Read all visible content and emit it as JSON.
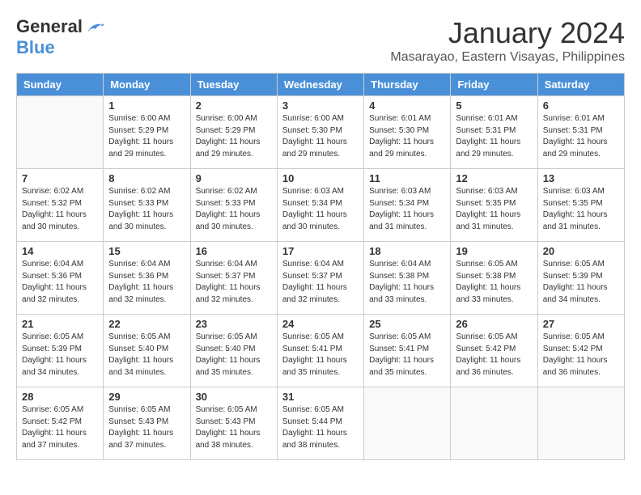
{
  "header": {
    "logo_general": "General",
    "logo_blue": "Blue",
    "month_title": "January 2024",
    "location": "Masarayao, Eastern Visayas, Philippines"
  },
  "weekdays": [
    "Sunday",
    "Monday",
    "Tuesday",
    "Wednesday",
    "Thursday",
    "Friday",
    "Saturday"
  ],
  "weeks": [
    [
      {
        "day": "",
        "sunrise": "",
        "sunset": "",
        "daylight": ""
      },
      {
        "day": "1",
        "sunrise": "Sunrise: 6:00 AM",
        "sunset": "Sunset: 5:29 PM",
        "daylight": "Daylight: 11 hours and 29 minutes."
      },
      {
        "day": "2",
        "sunrise": "Sunrise: 6:00 AM",
        "sunset": "Sunset: 5:29 PM",
        "daylight": "Daylight: 11 hours and 29 minutes."
      },
      {
        "day": "3",
        "sunrise": "Sunrise: 6:00 AM",
        "sunset": "Sunset: 5:30 PM",
        "daylight": "Daylight: 11 hours and 29 minutes."
      },
      {
        "day": "4",
        "sunrise": "Sunrise: 6:01 AM",
        "sunset": "Sunset: 5:30 PM",
        "daylight": "Daylight: 11 hours and 29 minutes."
      },
      {
        "day": "5",
        "sunrise": "Sunrise: 6:01 AM",
        "sunset": "Sunset: 5:31 PM",
        "daylight": "Daylight: 11 hours and 29 minutes."
      },
      {
        "day": "6",
        "sunrise": "Sunrise: 6:01 AM",
        "sunset": "Sunset: 5:31 PM",
        "daylight": "Daylight: 11 hours and 29 minutes."
      }
    ],
    [
      {
        "day": "7",
        "sunrise": "Sunrise: 6:02 AM",
        "sunset": "Sunset: 5:32 PM",
        "daylight": "Daylight: 11 hours and 30 minutes."
      },
      {
        "day": "8",
        "sunrise": "Sunrise: 6:02 AM",
        "sunset": "Sunset: 5:33 PM",
        "daylight": "Daylight: 11 hours and 30 minutes."
      },
      {
        "day": "9",
        "sunrise": "Sunrise: 6:02 AM",
        "sunset": "Sunset: 5:33 PM",
        "daylight": "Daylight: 11 hours and 30 minutes."
      },
      {
        "day": "10",
        "sunrise": "Sunrise: 6:03 AM",
        "sunset": "Sunset: 5:34 PM",
        "daylight": "Daylight: 11 hours and 30 minutes."
      },
      {
        "day": "11",
        "sunrise": "Sunrise: 6:03 AM",
        "sunset": "Sunset: 5:34 PM",
        "daylight": "Daylight: 11 hours and 31 minutes."
      },
      {
        "day": "12",
        "sunrise": "Sunrise: 6:03 AM",
        "sunset": "Sunset: 5:35 PM",
        "daylight": "Daylight: 11 hours and 31 minutes."
      },
      {
        "day": "13",
        "sunrise": "Sunrise: 6:03 AM",
        "sunset": "Sunset: 5:35 PM",
        "daylight": "Daylight: 11 hours and 31 minutes."
      }
    ],
    [
      {
        "day": "14",
        "sunrise": "Sunrise: 6:04 AM",
        "sunset": "Sunset: 5:36 PM",
        "daylight": "Daylight: 11 hours and 32 minutes."
      },
      {
        "day": "15",
        "sunrise": "Sunrise: 6:04 AM",
        "sunset": "Sunset: 5:36 PM",
        "daylight": "Daylight: 11 hours and 32 minutes."
      },
      {
        "day": "16",
        "sunrise": "Sunrise: 6:04 AM",
        "sunset": "Sunset: 5:37 PM",
        "daylight": "Daylight: 11 hours and 32 minutes."
      },
      {
        "day": "17",
        "sunrise": "Sunrise: 6:04 AM",
        "sunset": "Sunset: 5:37 PM",
        "daylight": "Daylight: 11 hours and 32 minutes."
      },
      {
        "day": "18",
        "sunrise": "Sunrise: 6:04 AM",
        "sunset": "Sunset: 5:38 PM",
        "daylight": "Daylight: 11 hours and 33 minutes."
      },
      {
        "day": "19",
        "sunrise": "Sunrise: 6:05 AM",
        "sunset": "Sunset: 5:38 PM",
        "daylight": "Daylight: 11 hours and 33 minutes."
      },
      {
        "day": "20",
        "sunrise": "Sunrise: 6:05 AM",
        "sunset": "Sunset: 5:39 PM",
        "daylight": "Daylight: 11 hours and 34 minutes."
      }
    ],
    [
      {
        "day": "21",
        "sunrise": "Sunrise: 6:05 AM",
        "sunset": "Sunset: 5:39 PM",
        "daylight": "Daylight: 11 hours and 34 minutes."
      },
      {
        "day": "22",
        "sunrise": "Sunrise: 6:05 AM",
        "sunset": "Sunset: 5:40 PM",
        "daylight": "Daylight: 11 hours and 34 minutes."
      },
      {
        "day": "23",
        "sunrise": "Sunrise: 6:05 AM",
        "sunset": "Sunset: 5:40 PM",
        "daylight": "Daylight: 11 hours and 35 minutes."
      },
      {
        "day": "24",
        "sunrise": "Sunrise: 6:05 AM",
        "sunset": "Sunset: 5:41 PM",
        "daylight": "Daylight: 11 hours and 35 minutes."
      },
      {
        "day": "25",
        "sunrise": "Sunrise: 6:05 AM",
        "sunset": "Sunset: 5:41 PM",
        "daylight": "Daylight: 11 hours and 35 minutes."
      },
      {
        "day": "26",
        "sunrise": "Sunrise: 6:05 AM",
        "sunset": "Sunset: 5:42 PM",
        "daylight": "Daylight: 11 hours and 36 minutes."
      },
      {
        "day": "27",
        "sunrise": "Sunrise: 6:05 AM",
        "sunset": "Sunset: 5:42 PM",
        "daylight": "Daylight: 11 hours and 36 minutes."
      }
    ],
    [
      {
        "day": "28",
        "sunrise": "Sunrise: 6:05 AM",
        "sunset": "Sunset: 5:42 PM",
        "daylight": "Daylight: 11 hours and 37 minutes."
      },
      {
        "day": "29",
        "sunrise": "Sunrise: 6:05 AM",
        "sunset": "Sunset: 5:43 PM",
        "daylight": "Daylight: 11 hours and 37 minutes."
      },
      {
        "day": "30",
        "sunrise": "Sunrise: 6:05 AM",
        "sunset": "Sunset: 5:43 PM",
        "daylight": "Daylight: 11 hours and 38 minutes."
      },
      {
        "day": "31",
        "sunrise": "Sunrise: 6:05 AM",
        "sunset": "Sunset: 5:44 PM",
        "daylight": "Daylight: 11 hours and 38 minutes."
      },
      {
        "day": "",
        "sunrise": "",
        "sunset": "",
        "daylight": ""
      },
      {
        "day": "",
        "sunrise": "",
        "sunset": "",
        "daylight": ""
      },
      {
        "day": "",
        "sunrise": "",
        "sunset": "",
        "daylight": ""
      }
    ]
  ]
}
